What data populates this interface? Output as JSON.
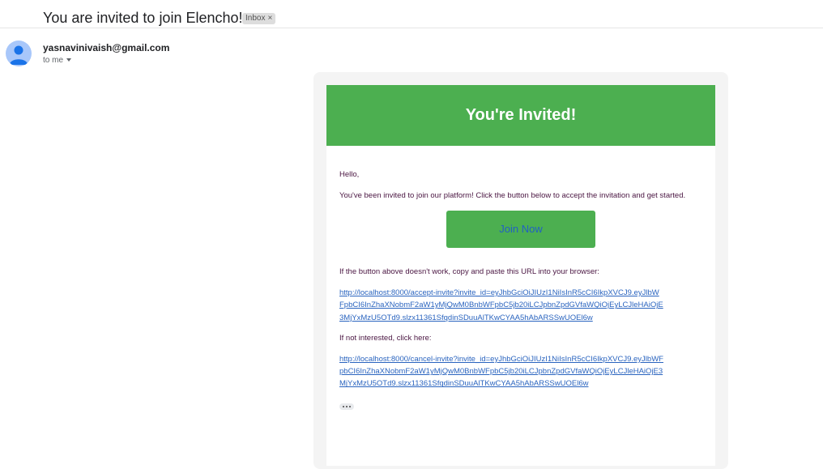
{
  "header": {
    "subject": "You are invited to join Elencho!",
    "label_chip": "Inbox",
    "chip_close": "×"
  },
  "sender": {
    "email": "yasnavinivaish@gmail.com",
    "recipient": "to me"
  },
  "email": {
    "banner_title": "You're Invited!",
    "greeting": "Hello,",
    "intro": "You've been invited to join our platform! Click the button below to accept the invitation and get started.",
    "button_label": "Join Now",
    "fallback_text": "If the button above doesn't work, copy and paste this URL into your browser:",
    "accept_url": "http://localhost:8000/accept-invite?invite_id=eyJhbGciOiJIUzI1NiIsInR5cCI6IkpXVCJ9.eyJlbWFpbCI6InZhaXNobmF2aW1yMjQwM0BnbWFpbC5jb20iLCJpbnZpdGVfaWQiOjEyLCJleHAiOjE3MjYxMzU5OTd9.slzx11361SfqdinSDuuAlTKwCYAA5hAbARSSwUOEl6w",
    "decline_text": "If not interested, click here:",
    "cancel_url": "http://localhost:8000/cancel-invite?invite_id=eyJhbGciOiJIUzI1NiIsInR5cCI6IkpXVCJ9.eyJlbWFpbCI6InZhaXNobmF2aW1yMjQwM0BnbWFpbC5jb20iLCJpbnZpdGVfaWQiOjEyLCJleHAiOjE3MjYxMzU5OTd9.slzx11361SfqdinSDuuAlTKwCYAA5hAbARSSwUOEl6w"
  },
  "colors": {
    "banner": "#4caf50",
    "button": "#4caf50",
    "button_text": "#2160c4",
    "body_text": "#4a1642",
    "link": "#2a64bf",
    "avatar": "#a8c7fa"
  },
  "icons": {
    "avatar": "person-icon",
    "dropdown": "chevron-down-icon",
    "trimmed": "more-horizontal-icon"
  }
}
